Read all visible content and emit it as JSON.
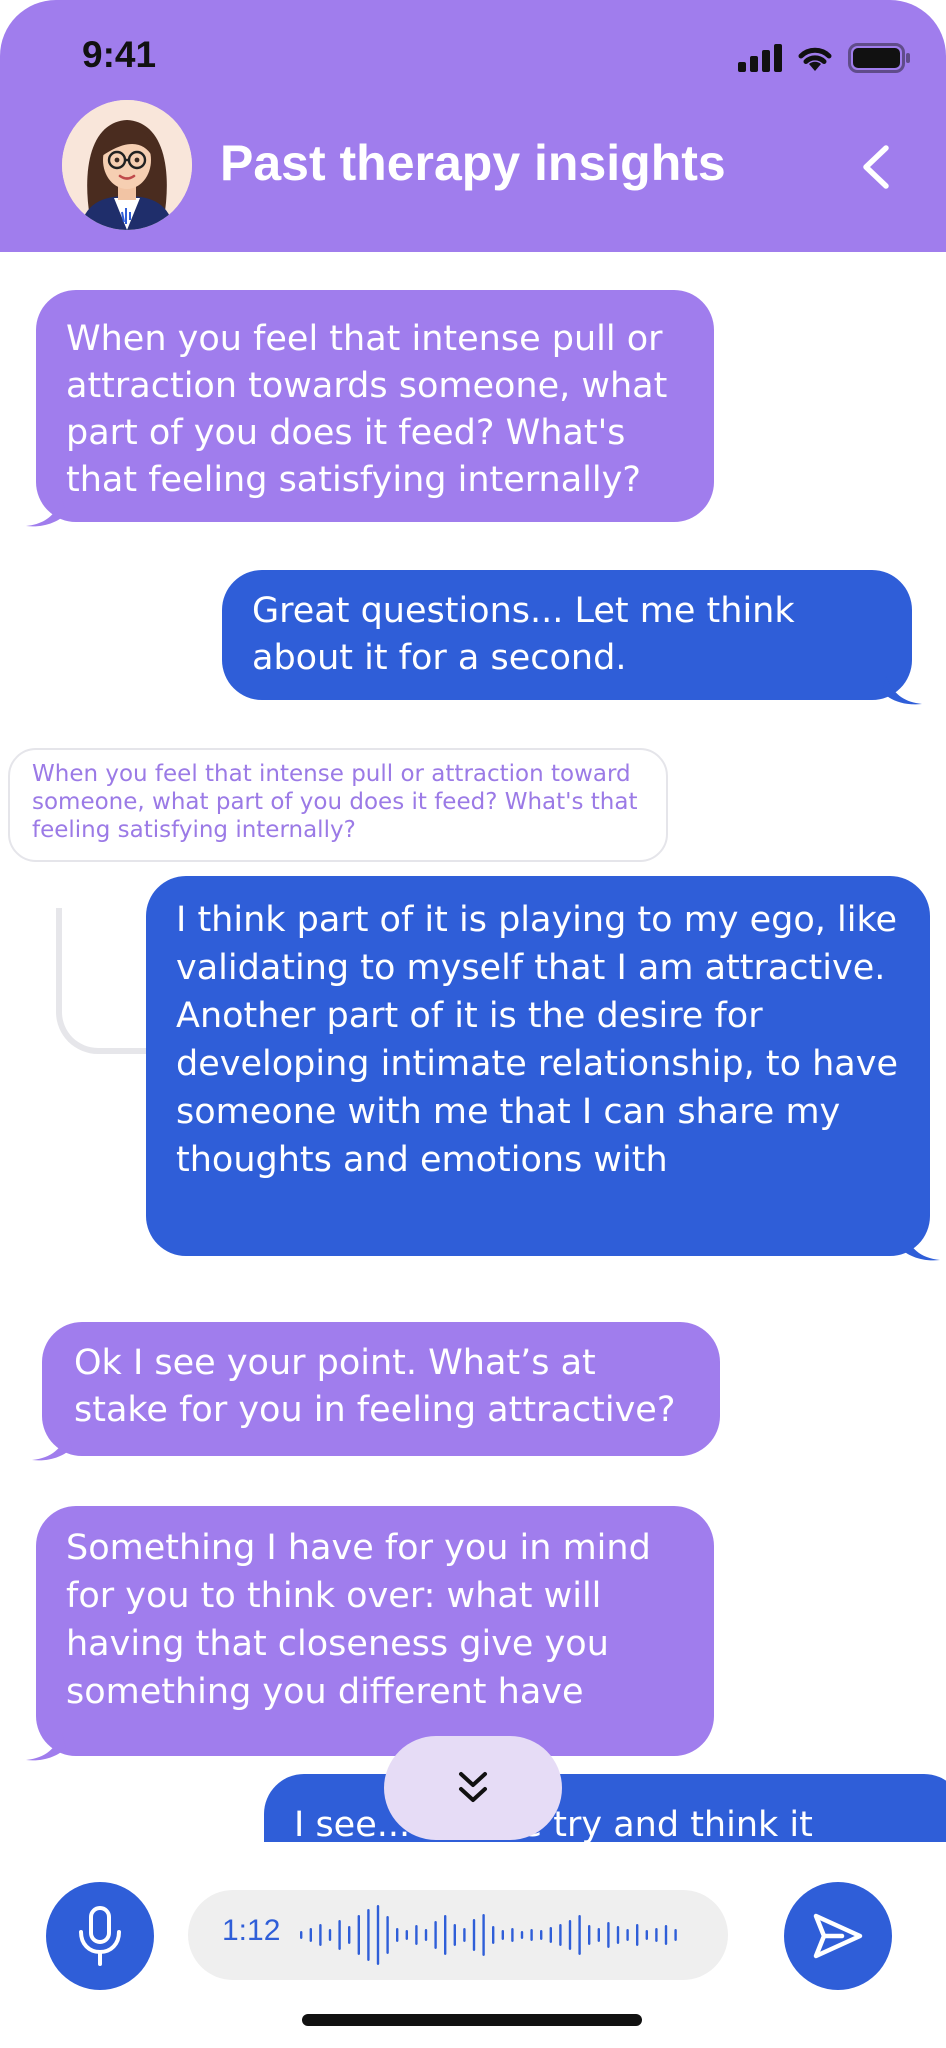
{
  "status_bar": {
    "time": "9:41"
  },
  "header": {
    "title": "Past therapy insights"
  },
  "messages": {
    "m1": "When you feel that intense pull or attraction towards someone, what part of you does it feed? What's that feeling satisfying internally?",
    "m2": "Great questions... Let me think about it for a second.",
    "quote": "When you feel that intense pull or attraction toward someone, what part of you does it feed? What's that feeling satisfying internally?",
    "m3": "I think part of it is playing to my ego, like validating to myself that I am attractive. Another part of it is the desire for developing intimate relationship, to have someone with me that I can share my thoughts and emotions with",
    "m4": "Ok I see your point. What’s at stake for you in feeling attractive?",
    "m5": "Something I have for you in mind for you to think over: what will having that closeness give you something you different have",
    "m6": "I see... Let me try and think it"
  },
  "composer": {
    "duration": "1:12"
  },
  "colors": {
    "accent_purple": "#a07ded",
    "user_blue": "#2f5ed8",
    "quote_text": "#9b7ae6"
  },
  "icons": [
    "avatar",
    "back-chevron-icon",
    "mic-icon",
    "send-icon",
    "chevrons-down-icon",
    "signal-icon",
    "wifi-icon",
    "battery-icon"
  ]
}
